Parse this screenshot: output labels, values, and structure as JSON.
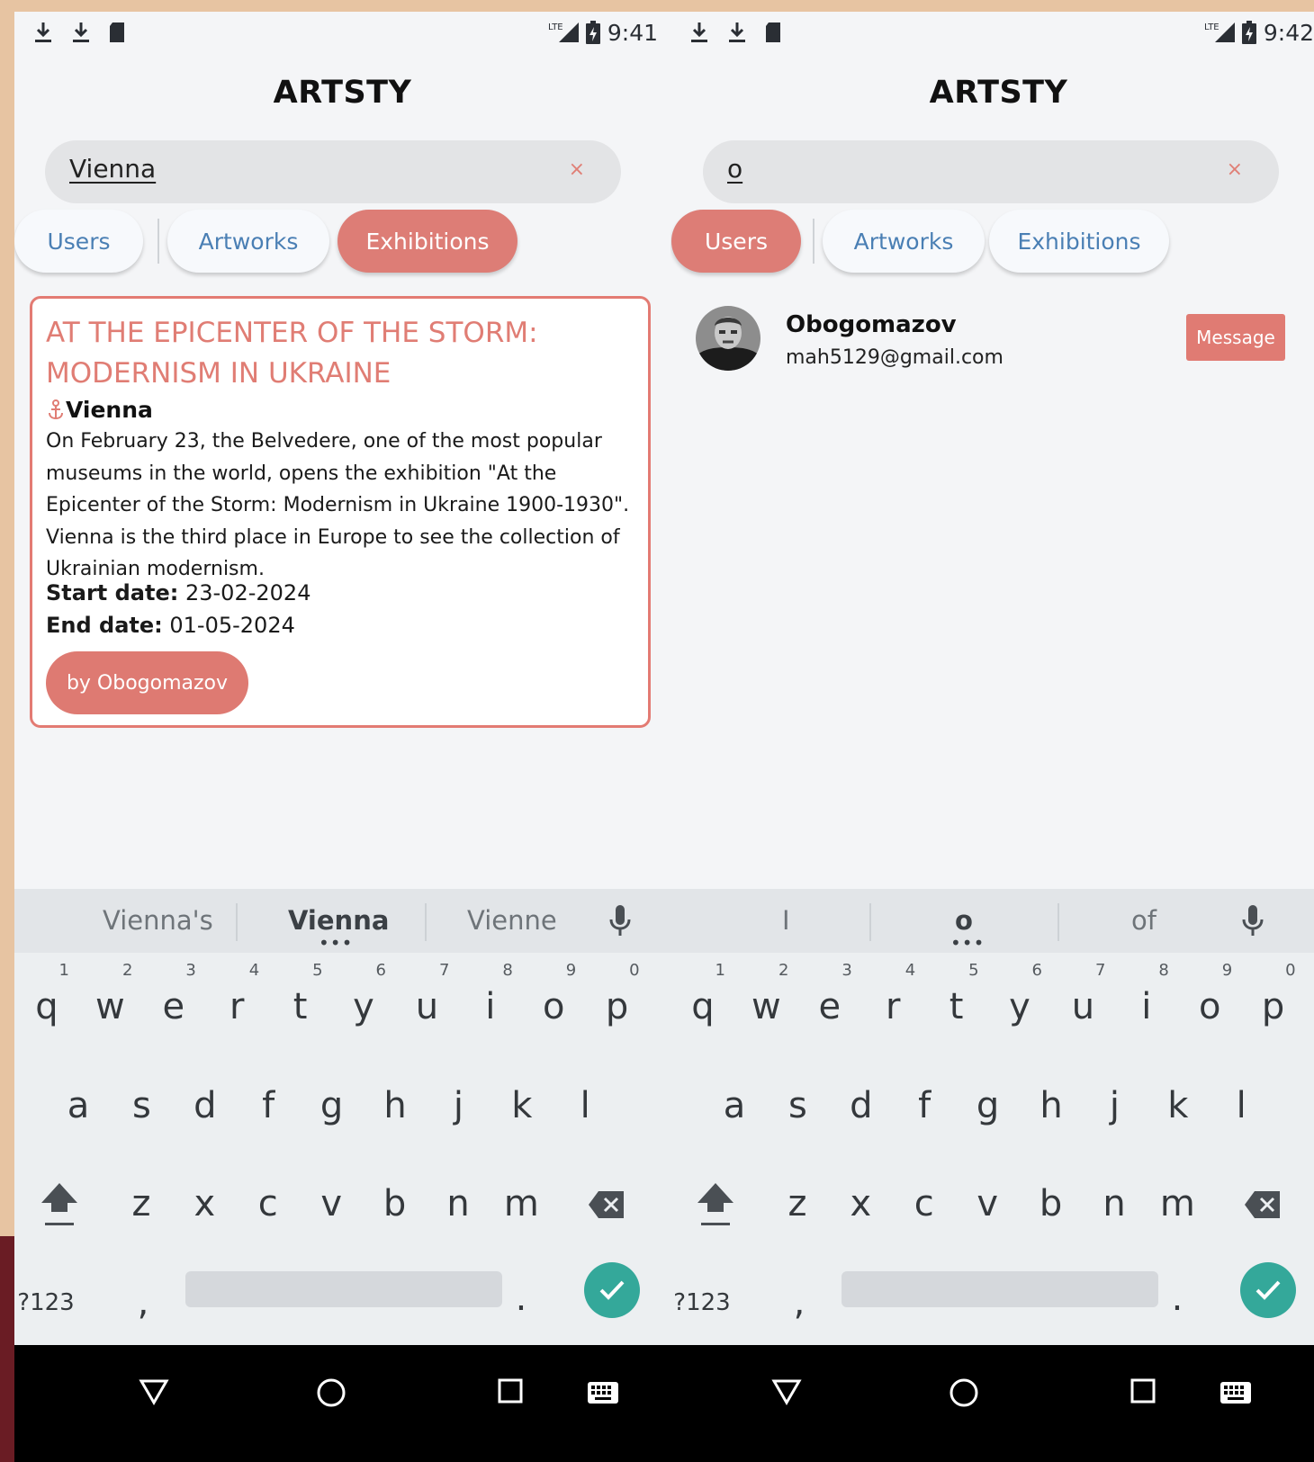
{
  "panels": [
    {
      "status_time": "9:41",
      "app_title": "ARTSTY",
      "search": {
        "value": "Vienna",
        "clear_icon": "×"
      },
      "tabs": [
        "Users",
        "Artworks",
        "Exhibitions"
      ],
      "active_tab": "Exhibitions",
      "exhibition": {
        "title": "AT THE EPICENTER OF THE STORM: MODERNISM IN UKRAINE",
        "location": "Vienna",
        "description": "On February 23, the Belvedere, one of the most popular museums in the world, opens the exhibition \"At the Epicenter of the Storm: Modernism in Ukraine 1900-1930\". Vienna is the third place in Europe to see the collection of Ukrainian modernism.",
        "start_label": "Start date:",
        "start_value": "23-02-2024",
        "end_label": "End date:",
        "end_value": "01-05-2024",
        "author_button": "by Obogomazov"
      },
      "suggestions": [
        "Vienna's",
        "Vienna",
        "Vienne"
      ],
      "suggestion_dots": "•••"
    },
    {
      "status_time": "9:42",
      "app_title": "ARTSTY",
      "search": {
        "value": "o",
        "clear_icon": "×"
      },
      "tabs": [
        "Users",
        "Artworks",
        "Exhibitions"
      ],
      "active_tab": "Users",
      "user": {
        "name": "Obogomazov",
        "email": "mah5129@gmail.com",
        "message_button": "Message"
      },
      "suggestions": [
        "I",
        "o",
        "of"
      ],
      "suggestion_dots": "•••"
    }
  ],
  "keyboard": {
    "row1": [
      "q",
      "w",
      "e",
      "r",
      "t",
      "y",
      "u",
      "i",
      "o",
      "p"
    ],
    "row1_hints": [
      "1",
      "2",
      "3",
      "4",
      "5",
      "6",
      "7",
      "8",
      "9",
      "0"
    ],
    "row2": [
      "a",
      "s",
      "d",
      "f",
      "g",
      "h",
      "j",
      "k",
      "l"
    ],
    "row3": [
      "z",
      "x",
      "c",
      "v",
      "b",
      "n",
      "m"
    ],
    "symbols_key": "?123",
    "comma_key": ",",
    "period_key": "."
  },
  "colors": {
    "accent": "#dd7d76",
    "tab_text": "#4a7fb4",
    "enter": "#34a89a",
    "frame": "#e7c4a2"
  },
  "icons": [
    "download-icon",
    "sd-card-icon",
    "lte-signal-icon",
    "battery-charging-icon",
    "clear-icon",
    "location-pin-icon",
    "mic-icon",
    "shift-icon",
    "backspace-icon",
    "check-icon",
    "nav-back-icon",
    "nav-home-icon",
    "nav-recents-icon",
    "keyboard-icon"
  ]
}
